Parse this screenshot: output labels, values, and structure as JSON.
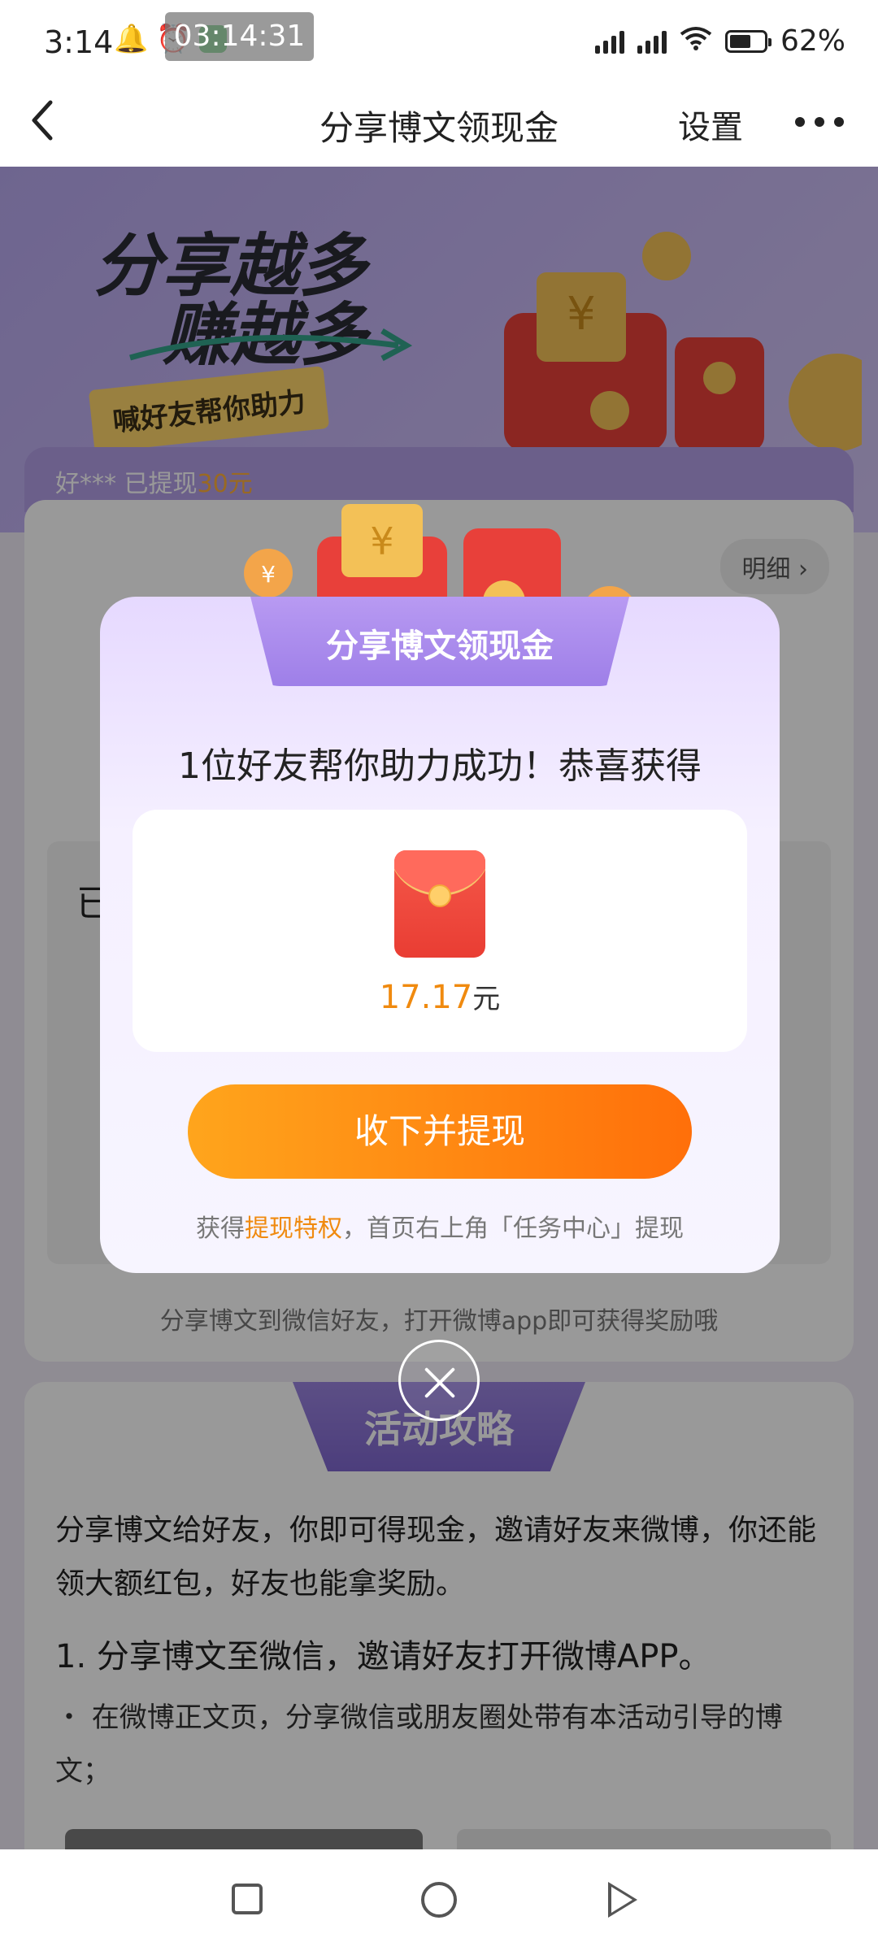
{
  "status_bar": {
    "time": "3:14",
    "recording": "03:14:31",
    "battery": "62%",
    "battery_level": 0.62
  },
  "nav": {
    "title": "分享博文领现金",
    "settings": "设置"
  },
  "banner": {
    "title_line1": "分享越多",
    "title_line2": "赚越多",
    "subtitle": "喊好友帮你助力"
  },
  "ticker": {
    "prefix": "好*** 已提现",
    "amount": "30元"
  },
  "card": {
    "detail": "明细 ›",
    "partial_label": "已",
    "footer": "分享博文到微信好友，打开微博app即可获得奖励哦"
  },
  "guide": {
    "title": "活动攻略",
    "intro": "分享博文给好友，你即可得现金，邀请好友来微博，你还能领大额红包，好友也能拿奖励。",
    "step1": "1. 分享博文至微信，邀请好友打开微博APP。",
    "step1_note": "・ 在微博正文页，分享微信或朋友圈处带有本活动引导的博文；"
  },
  "modal": {
    "title": "分享博文领现金",
    "message": "1位好友帮你助力成功！恭喜获得",
    "amount": "17.17",
    "unit": "元",
    "cta": "收下并提现",
    "note_prefix": "获得",
    "note_highlight": "提现特权",
    "note_suffix": "，首页右上角「任务中心」提现"
  }
}
